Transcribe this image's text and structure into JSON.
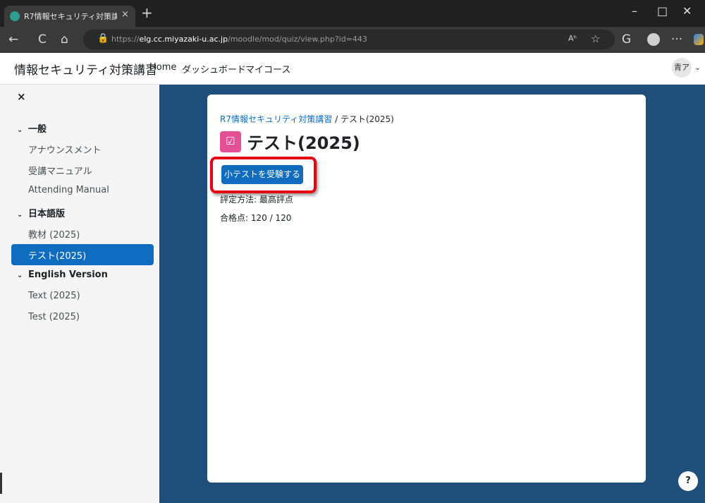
{
  "browser": {
    "tab_title": "R7情報セキュリティ対策講習: テスト(",
    "tab_close": "×",
    "new_tab": "+",
    "win_min": "–",
    "win_max": "□",
    "win_close": "✕",
    "back": "←",
    "reload": "C",
    "home": "⌂",
    "url_prefix": "https://",
    "url_host": "elg.cc.miyazaki-u.ac.jp",
    "url_path": "/moodle/mod/quiz/view.php?id=443",
    "read_aloud": "Aʰ",
    "favorite": "☆",
    "more": "···"
  },
  "header": {
    "site_name": "情報セキュリティ対策講習",
    "nav": [
      "Home",
      "ダッシュボード",
      "マイコース"
    ],
    "avatar": "青ア",
    "caret": "⌄"
  },
  "drawer": {
    "close": "×",
    "sections": [
      {
        "label": "一般",
        "items": [
          "アナウンスメント",
          "受講マニュアル",
          "Attending Manual"
        ]
      },
      {
        "label": "日本語版",
        "items": [
          "教材 (2025)",
          "テスト(2025)"
        ]
      },
      {
        "label": "English Version",
        "items": [
          "Text (2025)",
          "Test (2025)"
        ]
      }
    ],
    "chevron": "⌄",
    "active_item": "テスト(2025)"
  },
  "main": {
    "breadcrumb_course": "R7情報セキュリティ対策講習",
    "breadcrumb_sep": " / ",
    "breadcrumb_current": "テスト(2025)",
    "quiz_icon": "☑",
    "title": "テスト(2025)",
    "attempt_button": "小テストを受験する",
    "grading_method": "評定方法: 最高評点",
    "pass_grade": "合格点: 120 / 120",
    "help": "?"
  },
  "colors": {
    "primary": "#0f6cbf",
    "page_bg": "#1e4e79",
    "highlight": "#e60012",
    "quiz_icon_bg": "#e35094"
  }
}
